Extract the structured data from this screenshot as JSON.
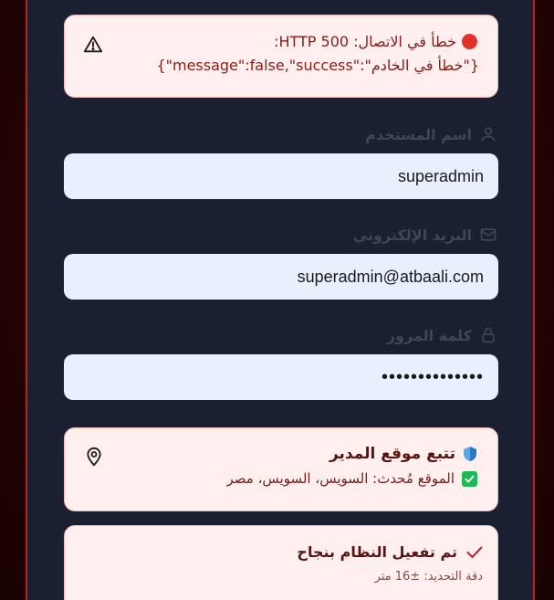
{
  "error": {
    "line1": "خطأ في الاتصال: HTTP 500:",
    "line2": "{\"message\":false,\"success\":\"خطأ في الخادم\"}",
    "icon": "warning-triangle-icon",
    "dot_color": "#e0312a"
  },
  "form": {
    "username_label": "اسم المستخدم",
    "username_value": "superadmin",
    "email_label": "البريد الإلكتروني",
    "email_value": "superadmin@atbaali.com",
    "password_label": "كلمة المرور",
    "password_value": "••••••••••••••"
  },
  "location": {
    "title": "تتبع موقع المدير",
    "status": "الموقع مُحدث: السويس، السويس، مصر",
    "icon": "map-pin-icon"
  },
  "success": {
    "title": "تم تفعيل النظام بنجاح",
    "accuracy": "دقة التحديد: ±16 متر"
  },
  "colors": {
    "accent_red": "#b8231f",
    "panel_bg": "#1a2032",
    "input_bg": "#e8f0fe",
    "alert_bg": "#fff0ef",
    "success_green": "#1db954"
  }
}
